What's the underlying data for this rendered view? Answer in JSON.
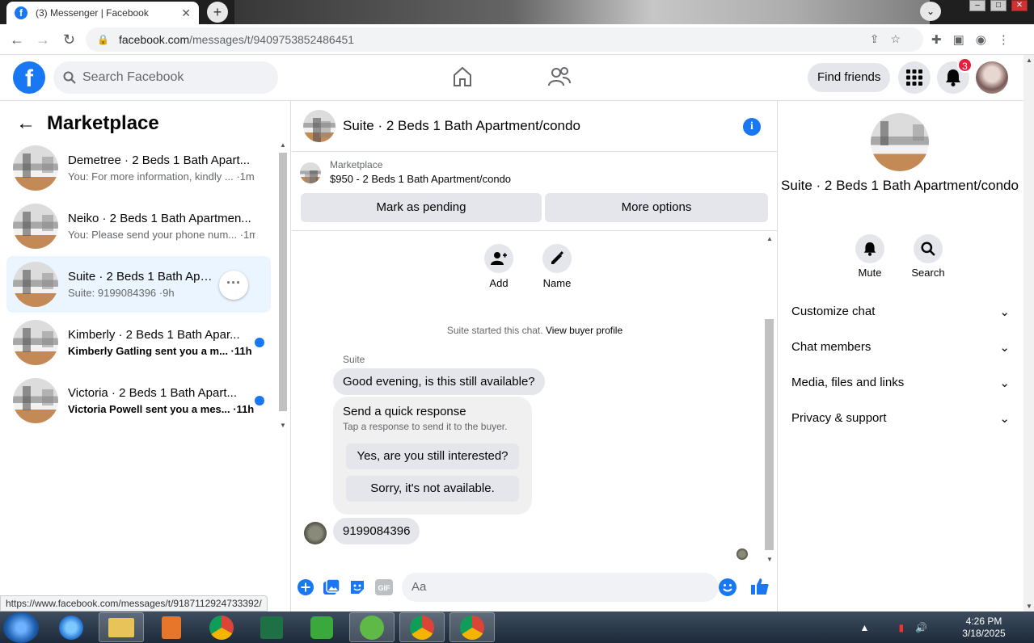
{
  "browser": {
    "tab_title": "(3) Messenger | Facebook",
    "url_host": "facebook.com",
    "url_path": "/messages/t/9409753852486451",
    "status_url": "https://www.facebook.com/messages/t/9187112924733392/"
  },
  "header": {
    "search_placeholder": "Search Facebook",
    "find_friends": "Find friends",
    "notification_count": "3"
  },
  "left": {
    "title": "Marketplace",
    "conversations": [
      {
        "name": "Demetree · 2 Beds 1 Bath Apart...",
        "preview": "You: For more information, kindly ... ·1m",
        "unread": false
      },
      {
        "name": "Neiko · 2 Beds 1 Bath Apartmen...",
        "preview": "You: Please send your phone num... ·1m",
        "unread": false
      },
      {
        "name": "Suite · 2 Beds 1 Bath Apartm...",
        "preview": "Suite: 9199084396 ·9h",
        "unread": false
      },
      {
        "name": "Kimberly · 2 Beds 1 Bath Apar...",
        "preview": "Kimberly Gatling sent you a m... ·11h",
        "unread": true
      },
      {
        "name": "Victoria · 2 Beds 1 Bath Apart...",
        "preview": "Victoria Powell sent you a mes... ·11h",
        "unread": true
      }
    ]
  },
  "thread": {
    "title": "Suite · 2 Beds 1 Bath Apartment/condo",
    "marketplace_label": "Marketplace",
    "listing": "$950 - 2 Beds 1 Bath Apartment/condo",
    "mark_pending": "Mark as pending",
    "more_options": "More options",
    "add_label": "Add",
    "name_label": "Name",
    "started_text": "Suite started this chat.",
    "view_buyer": "View buyer profile",
    "sender": "Suite",
    "message1": "Good evening, is this still available?",
    "quick_title": "Send a quick response",
    "quick_sub": "Tap a response to send it to the buyer.",
    "quick_opt1": "Yes, are you still interested?",
    "quick_opt2": "Sorry, it's not available.",
    "message2": "9199084396",
    "composer_placeholder": "Aa"
  },
  "right": {
    "title": "Suite · 2 Beds 1 Bath Apartment/condo",
    "mute": "Mute",
    "search": "Search",
    "sections": [
      "Customize chat",
      "Chat members",
      "Media, files and links",
      "Privacy & support"
    ]
  },
  "taskbar": {
    "time": "4:26 PM",
    "date": "3/18/2025"
  },
  "colors": {
    "facebook_blue": "#1877f2",
    "badge_red": "#e41e3f"
  }
}
